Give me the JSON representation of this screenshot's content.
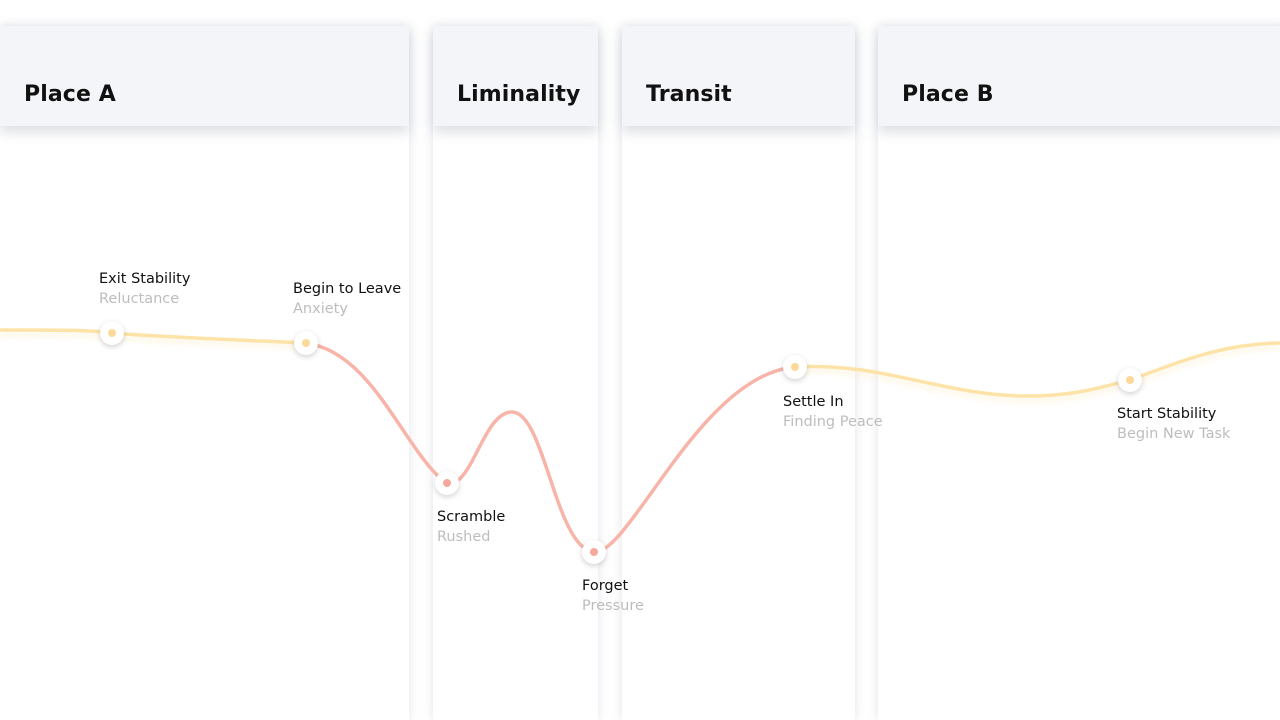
{
  "colors": {
    "stable": "#fde3a7",
    "stable_dot": "#fbd99a",
    "stress": "#f8b4a8",
    "stress_dot": "#f5a89b"
  },
  "lanes": [
    {
      "title": "Place A"
    },
    {
      "title": "Liminality"
    },
    {
      "title": "Transit"
    },
    {
      "title": "Place B"
    }
  ],
  "stages": [
    {
      "name": "Exit Stability",
      "feeling": "Reluctance",
      "tone": "stable"
    },
    {
      "name": "Begin to Leave",
      "feeling": "Anxiety",
      "tone": "stable"
    },
    {
      "name": "Scramble",
      "feeling": "Rushed",
      "tone": "stress"
    },
    {
      "name": "Forget",
      "feeling": "Pressure",
      "tone": "stress"
    },
    {
      "name": "Settle In",
      "feeling": "Finding Peace",
      "tone": "stable"
    },
    {
      "name": "Start Stability",
      "feeling": "Begin New Task",
      "tone": "stable"
    }
  ]
}
